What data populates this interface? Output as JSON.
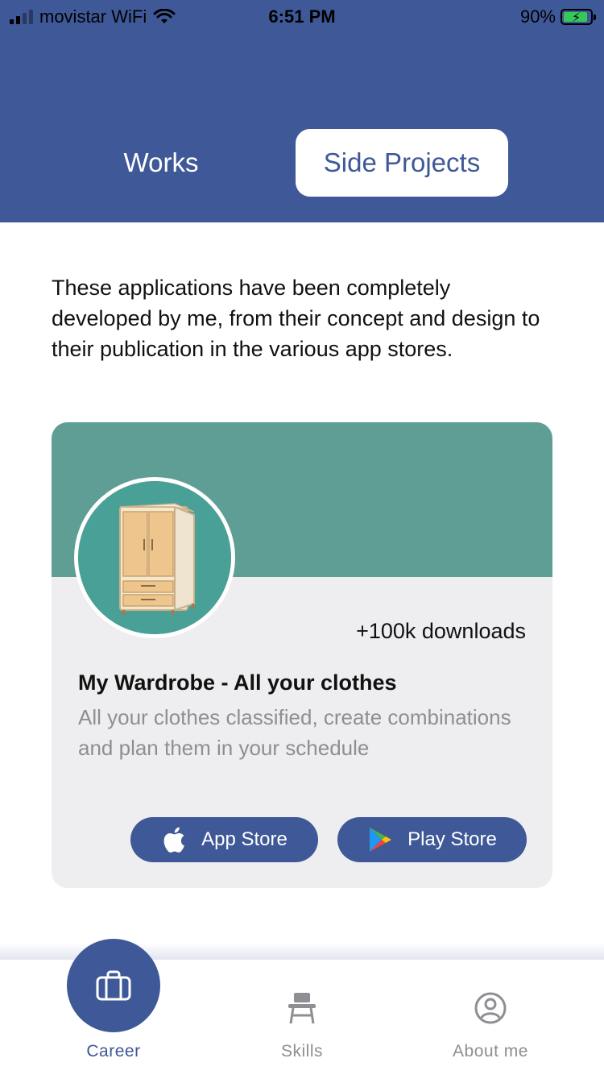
{
  "status_bar": {
    "carrier": "movistar WiFi",
    "time": "6:51 PM",
    "battery": "90%",
    "battery_level": 0.9
  },
  "tabs": [
    {
      "label": "Works",
      "selected": false
    },
    {
      "label": "Side Projects",
      "selected": true
    }
  ],
  "intro_text": "These applications have been completely developed by me, from their concept and design to their publication in the various app stores.",
  "app_card": {
    "downloads": "+100k downloads",
    "title": "My Wardrobe - All your clothes",
    "description": "All your clothes classified, create combinations and plan them in your schedule",
    "app_store_label": "App Store",
    "play_store_label": "Play Store",
    "banner_color": "#5f9e95"
  },
  "bottom_nav": [
    {
      "label": "Career",
      "icon": "briefcase-icon",
      "active": true
    },
    {
      "label": "Skills",
      "icon": "school-desk-icon",
      "active": false
    },
    {
      "label": "About me",
      "icon": "user-circle-icon",
      "active": false
    }
  ],
  "colors": {
    "primary": "#3f5897",
    "card_background": "#eeeef0",
    "muted_text": "#8e8e93"
  }
}
